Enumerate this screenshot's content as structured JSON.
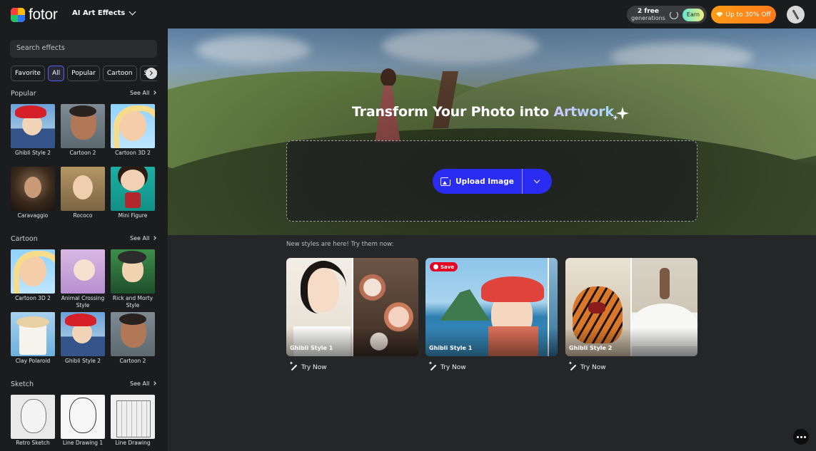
{
  "topbar": {
    "brand": "fotor",
    "menu_label": "AI Art Effects",
    "generations_count": "2 free",
    "generations_label": "generations",
    "earn_label": "Earn",
    "promo_label": "Up to 30% Off"
  },
  "sidebar": {
    "search_placeholder": "Search effects",
    "chips": [
      "Favorite",
      "All",
      "Popular",
      "Cartoon",
      "Sketch"
    ],
    "active_chip": "All",
    "see_all_label": "See All",
    "sections": [
      {
        "title": "Popular",
        "items": [
          "Ghibli Style 2",
          "Cartoon 2",
          "Cartoon 3D 2",
          "Caravaggio",
          "Rococo",
          "Mini Figure"
        ]
      },
      {
        "title": "Cartoon",
        "items": [
          "Cartoon 3D 2",
          "Animal Crossing Style",
          "Rick and Morty Style",
          "Clay Polaroid",
          "Ghibli Style 2",
          "Cartoon 2"
        ]
      },
      {
        "title": "Sketch",
        "items": [
          "Retro Sketch",
          "Line Drawing 1",
          "Line Drawing"
        ]
      }
    ]
  },
  "hero": {
    "title_prefix": "Transform Your Photo into",
    "title_accent": "Artwork",
    "upload_label": "Upload Image"
  },
  "new_styles": {
    "label": "New styles are here! Try them now:",
    "save_label": "Save",
    "try_label": "Try Now",
    "cards": [
      {
        "label": "Ghibli Style 1"
      },
      {
        "label": "Ghibli Style 1"
      },
      {
        "label": "Ghibli Style 2"
      }
    ]
  },
  "colors": {
    "accent_blue": "#2a2cf2",
    "promo_orange": "#ff8a1a",
    "pinterest_red": "#e60023",
    "sidebar_bg": "#1b1c1e",
    "page_bg": "#252628"
  }
}
